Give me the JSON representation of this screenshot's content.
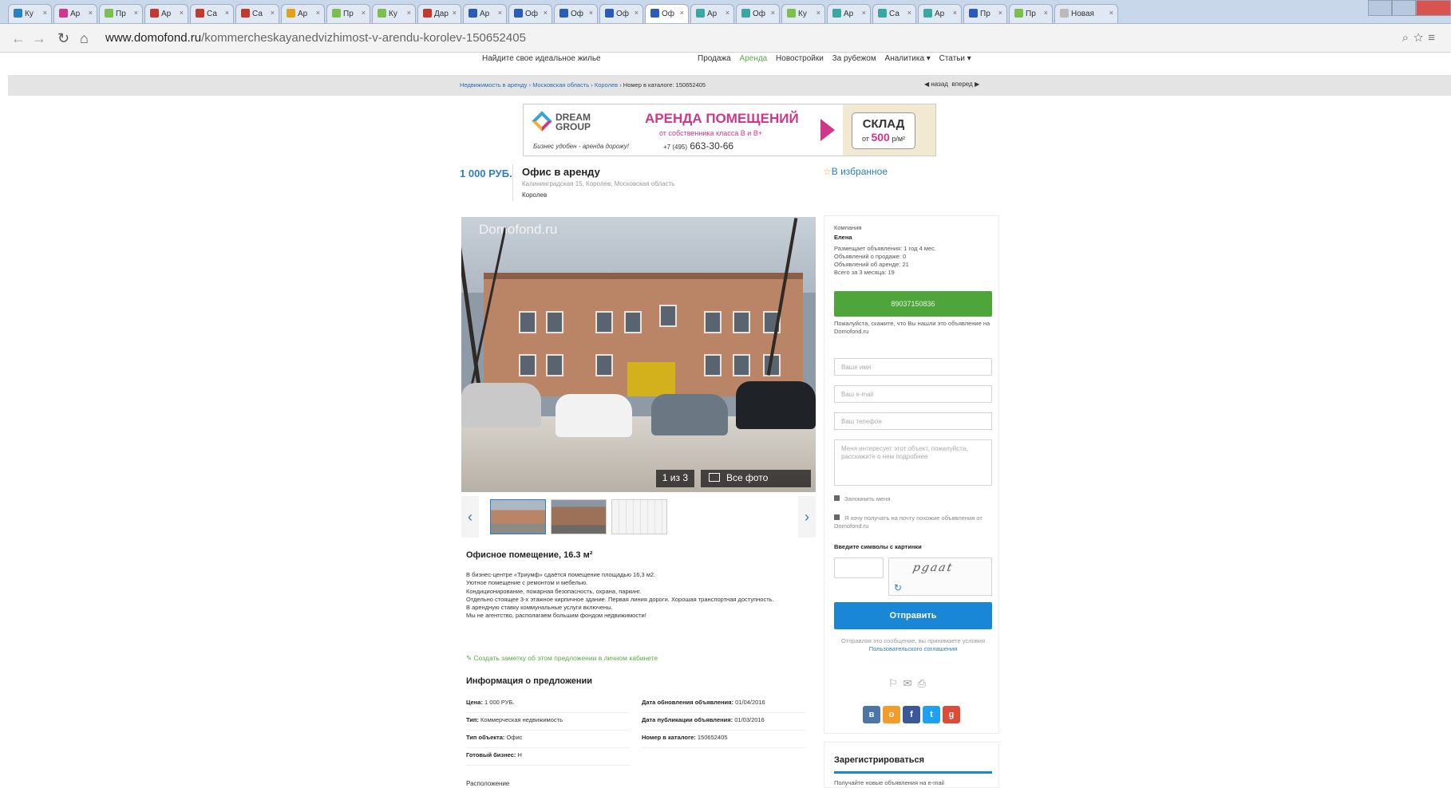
{
  "browser": {
    "tabs": [
      {
        "title": "Ку",
        "color": "#2a7fc5"
      },
      {
        "title": "Ар",
        "color": "#d0368a"
      },
      {
        "title": "Пр",
        "color": "#7cbf4f"
      },
      {
        "title": "Ар",
        "color": "#c23a2e"
      },
      {
        "title": "Са",
        "color": "#c23a2e"
      },
      {
        "title": "Са",
        "color": "#c23a2e"
      },
      {
        "title": "Ар",
        "color": "#e0a21a"
      },
      {
        "title": "Пр",
        "color": "#7cbf4f"
      },
      {
        "title": "Ку",
        "color": "#7cbf4f"
      },
      {
        "title": "Дар",
        "color": "#c23a2e"
      },
      {
        "title": "Ар",
        "color": "#2a5bb8"
      },
      {
        "title": "Оф",
        "color": "#2a5bb8"
      },
      {
        "title": "Оф",
        "color": "#2a5bb8"
      },
      {
        "title": "Оф",
        "color": "#2a5bb8"
      },
      {
        "title": "Оф",
        "color": "#2a5bb8",
        "active": true
      },
      {
        "title": "Ар",
        "color": "#3aa7a0"
      },
      {
        "title": "Оф",
        "color": "#3aa7a0"
      },
      {
        "title": "Ку",
        "color": "#7cbf4f"
      },
      {
        "title": "Ар",
        "color": "#3aa7a0"
      },
      {
        "title": "Са",
        "color": "#3aa7a0"
      },
      {
        "title": "Ар",
        "color": "#3aa7a0"
      },
      {
        "title": "Пр",
        "color": "#2a5bb8"
      },
      {
        "title": "Пр",
        "color": "#7cbf4f"
      },
      {
        "title": "Новая",
        "color": "#bbbbbb"
      }
    ],
    "url_host": "www.domofond.ru",
    "url_path": "/kommercheskayanedvizhimost-v-arendu-korolev-150652405"
  },
  "header": {
    "tagline": "Найдите свое идеальное жилье",
    "nav": [
      "Продажа",
      "Аренда",
      "Новостройки",
      "За рубежом",
      "Аналитика ▾",
      "Статьи ▾"
    ],
    "active_nav": "Аренда"
  },
  "breadcrumbs": {
    "items": [
      "Недвижимость в аренду",
      "Московская область",
      "Королев"
    ],
    "last": "Номер в каталоге: 150652405",
    "prev": "назад",
    "next": "вперед"
  },
  "banner": {
    "brand_line1": "DREAM",
    "brand_line2": "GROUP",
    "slogan": "Бизнес удобен - аренда дорожу!",
    "headline": "АРЕНДА ПОМЕЩЕНИЙ",
    "subline": "от собственника класса B и B+",
    "phone_prefix": "+7 (495)",
    "phone_number": "663-30-66",
    "warehouse": "СКЛАД",
    "from": "от",
    "price": "500",
    "unit": "р/м²"
  },
  "listing": {
    "price": "1 000 РУБ.",
    "title": "Офис в аренду",
    "address": "Калининградская 15, Королев, Московская область",
    "city": "Королев",
    "favorite": "В избранное",
    "photo_watermark": "Domofond.ru",
    "photo_counter": "1 из 3",
    "all_photos": "Все фото",
    "description_title": "Офисное помещение, 16.3 м²",
    "description_lines": [
      "В бизнес-центре «Триумф» сдаётся помещение площадью 16,3 м2.",
      "Уютное помещение с ремонтом и мебелью.",
      "Кондиционирование, пожарная безопасность, охрана, паркинг.",
      "Отдельно стоящее 3-х этажное кирпичное здание. Первая линия дороги. Хорошая транспортная доступность.",
      "В арендную ставку коммунальные услуги включены.",
      "Мы не агентство, располагаем большим фондом недвижимости!"
    ],
    "note_link": "Создать заметку об этом предложении в личном кабинете",
    "info_title": "Информация о предложении",
    "info": [
      {
        "label": "Цена:",
        "value": "1 000 РУБ."
      },
      {
        "label": "Дата обновления объявления:",
        "value": "01/04/2016"
      },
      {
        "label": "Тип:",
        "value": "Коммерческая недвижимость"
      },
      {
        "label": "Дата публикации объявления:",
        "value": "01/03/2016"
      },
      {
        "label": "Тип объекта:",
        "value": "Офис"
      },
      {
        "label": "Номер в каталоге:",
        "value": "150652405"
      },
      {
        "label": "Готовый бизнес:",
        "value": "Н"
      }
    ],
    "more_label": "Расположение"
  },
  "sidebar": {
    "company_label": "Компания",
    "company_name": "Елена",
    "stats": [
      "Размещает объявления: 1 год 4 мес.",
      "Объявлений о продаже: 0",
      "Объявлений об аренде: 21",
      "Всего за 3 месяца: 19"
    ],
    "phone_button": "89037150836",
    "phone_hint": "Пожалуйста, скажите, что Вы нашли это объявление на Domofond.ru",
    "name_placeholder": "Ваше имя",
    "email_placeholder": "Ваш e-mail",
    "phone_placeholder": "Ваш телефон",
    "message_placeholder": "Меня интересует этот объект, пожалуйста, расскажите о нем подробнее",
    "remember_label": "Запомнить меня",
    "subscribe_label": "Я хочу получать на почту похожие объявления от Domofond.ru",
    "captcha_label": "Введите символы с картинки",
    "captcha_text": "pgaat",
    "send_button": "Отправить",
    "terms_text": "Отправляя это сообщение, вы принимаете условия",
    "terms_link": "Пользовательского соглашения",
    "register_title": "Зарегистрироваться",
    "register_sub": "Получайте новые объявления на e-mail"
  },
  "colors": {
    "brand_blue": "#2a7fc5",
    "call_green": "#4ea63a",
    "send_blue": "#1a86d6",
    "banner_pink": "#d0368a"
  }
}
